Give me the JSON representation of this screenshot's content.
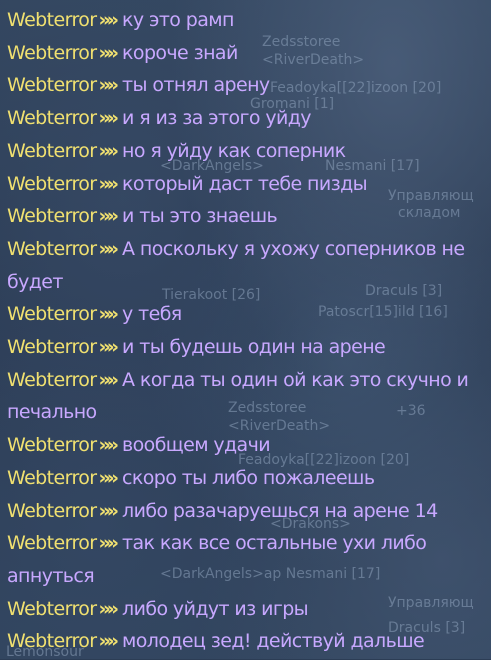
{
  "background_labels": [
    "Zedsstoree",
    "<RiverDeath>",
    "Feadoyka[[22]izoon [20]",
    "Gromani [1]",
    "Nesmani [17]",
    "<DarkAngels>",
    "Управляющ",
    "складом",
    "Tierakoot [26]",
    "Draculs [3]",
    "Patoscr[15]ild [16]",
    "Zedsstoree",
    "<RiverDeath>",
    "+36",
    "Feadoyka[[22]izoon [20]",
    "<Drakons>",
    "<DarkAngels>ap Nesmani [17]",
    "Управляющ",
    "Draculs [3]",
    "Lemonsour"
  ],
  "chat": {
    "messages": [
      {
        "sender": "Webterror",
        "text": "ку это рамп"
      },
      {
        "sender": "Webterror",
        "text": "короче знай"
      },
      {
        "sender": "Webterror",
        "text": "ты отнял арену"
      },
      {
        "sender": "Webterror",
        "text": "и я из за этого уйду"
      },
      {
        "sender": "Webterror",
        "text": "но я уйду как соперник"
      },
      {
        "sender": "Webterror",
        "text": "который даст тебе пизды"
      },
      {
        "sender": "Webterror",
        "text": "и ты это знаешь"
      },
      {
        "sender": "Webterror",
        "text": "А поскольку я ухожу соперников не будет"
      },
      {
        "sender": "Webterror",
        "text": "у тебя"
      },
      {
        "sender": "Webterror",
        "text": "и ты будешь один на арене"
      },
      {
        "sender": "Webterror",
        "text": "А когда ты один ой как это скучно и печально"
      },
      {
        "sender": "Webterror",
        "text": "вообщем удачи"
      },
      {
        "sender": "Webterror",
        "text": "скоро ты либо пожалеешь"
      },
      {
        "sender": "Webterror",
        "text": "либо разачаруешься на арене 14"
      },
      {
        "sender": "Webterror",
        "text": "так как все остальные ухи либо апнуться"
      },
      {
        "sender": "Webterror",
        "text": "либо уйдут из игры"
      },
      {
        "sender": "Webterror",
        "text": "молодец зед! действуй дальше"
      }
    ],
    "separator": "»»",
    "colors": {
      "sender": "#f0e070",
      "message": "#c8a8ff",
      "background": "#2c3d55"
    }
  }
}
